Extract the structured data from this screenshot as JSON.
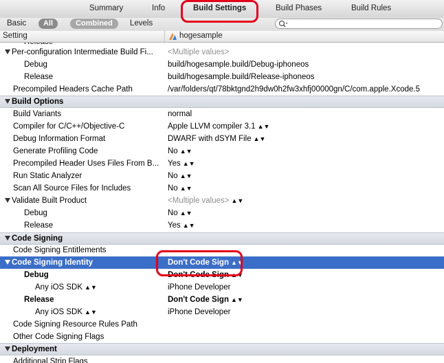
{
  "tabs": [
    {
      "label": "Summary",
      "active": false
    },
    {
      "label": "Info",
      "active": false
    },
    {
      "label": "Build Settings",
      "active": true
    },
    {
      "label": "Build Phases",
      "active": false
    },
    {
      "label": "Build Rules",
      "active": false
    }
  ],
  "filter": {
    "basic": "Basic",
    "all": "All",
    "combined": "Combined",
    "levels": "Levels",
    "search_placeholder": ""
  },
  "columns": {
    "setting": "Setting",
    "target": "hogesample"
  },
  "rows": {
    "r0": {
      "name": "Release",
      "value": ""
    },
    "r1": {
      "name": "Per-configuration Intermediate Build Fi...",
      "value": "<Multiple values>"
    },
    "r2": {
      "name": "Debug",
      "value": "build/hogesample.build/Debug-iphoneos"
    },
    "r3": {
      "name": "Release",
      "value": "build/hogesample.build/Release-iphoneos"
    },
    "r4": {
      "name": "Precompiled Headers Cache Path",
      "value": "/var/folders/qt/78bktgnd2h9dw0h2fw3xhfj00000gn/C/com.apple.Xcode.5"
    },
    "r5": {
      "name": "Build Options"
    },
    "r6": {
      "name": "Build Variants",
      "value": "normal"
    },
    "r7": {
      "name": "Compiler for C/C++/Objective-C",
      "value": "Apple LLVM compiler 3.1"
    },
    "r8": {
      "name": "Debug Information Format",
      "value": "DWARF with dSYM File"
    },
    "r9": {
      "name": "Generate Profiling Code",
      "value": "No"
    },
    "r10": {
      "name": "Precompiled Header Uses Files From B...",
      "value": "Yes"
    },
    "r11": {
      "name": "Run Static Analyzer",
      "value": "No"
    },
    "r12": {
      "name": "Scan All Source Files for Includes",
      "value": "No"
    },
    "r13": {
      "name": "Validate Built Product",
      "value": "<Multiple values>"
    },
    "r14": {
      "name": "Debug",
      "value": "No"
    },
    "r15": {
      "name": "Release",
      "value": "Yes"
    },
    "r16": {
      "name": "Code Signing"
    },
    "r17": {
      "name": "Code Signing Entitlements",
      "value": ""
    },
    "r18": {
      "name": "Code Signing Identity",
      "value": "Don't Code Sign"
    },
    "r19": {
      "name": "Debug",
      "value": "Don't Code Sign"
    },
    "r20": {
      "name": "Any iOS SDK",
      "value": "iPhone Developer"
    },
    "r21": {
      "name": "Release",
      "value": "Don't Code Sign"
    },
    "r22": {
      "name": "Any iOS SDK",
      "value": "iPhone Developer"
    },
    "r23": {
      "name": "Code Signing Resource Rules Path",
      "value": ""
    },
    "r24": {
      "name": "Other Code Signing Flags",
      "value": ""
    },
    "r25": {
      "name": "Deployment"
    },
    "r26": {
      "name": "Additional Strip Flags",
      "value": ""
    }
  },
  "colors": {
    "selection": "#3b6ec8",
    "highlight_annotation": "#e3001b"
  }
}
